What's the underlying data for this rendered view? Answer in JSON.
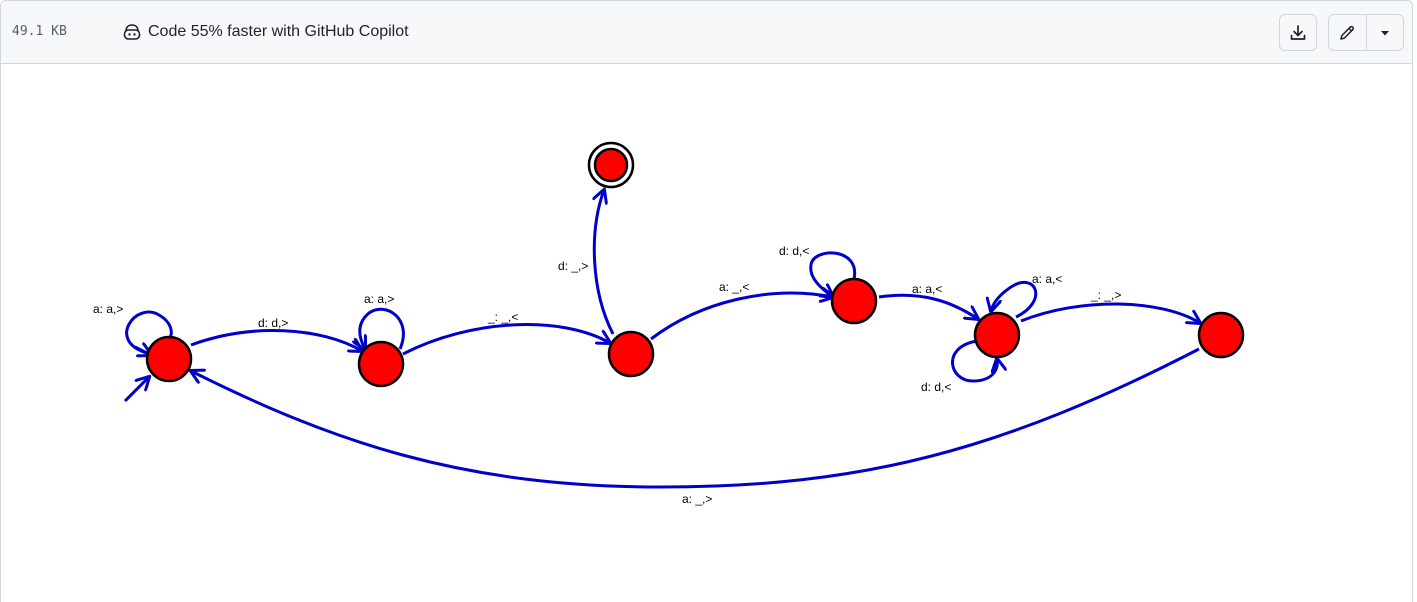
{
  "header": {
    "file_size": "49.1 KB",
    "copilot_text": "Code 55% faster with GitHub Copilot",
    "copilot_icon": "copilot-icon",
    "download_icon": "download-icon",
    "edit_icon": "pencil-icon",
    "more_icon": "triangle-down-icon"
  },
  "diagram": {
    "state_color": "#ff0000",
    "edge_color": "#0000cc",
    "transitions": {
      "q0_self": "a: a,>",
      "q0_q1": "d: d,>",
      "q1_self": "a: a,>",
      "q1_q2": "_: _,<",
      "q2_accept": "d: _,>",
      "q2_q3": "a: _,<",
      "q3_self": "d: d,<",
      "q3_q4": "a: a,<",
      "q4_self_top": "a: a,<",
      "q4_self_bottom": "d: d,<",
      "q4_q5": "_: _,>",
      "q5_q0": "a: _,>"
    }
  }
}
